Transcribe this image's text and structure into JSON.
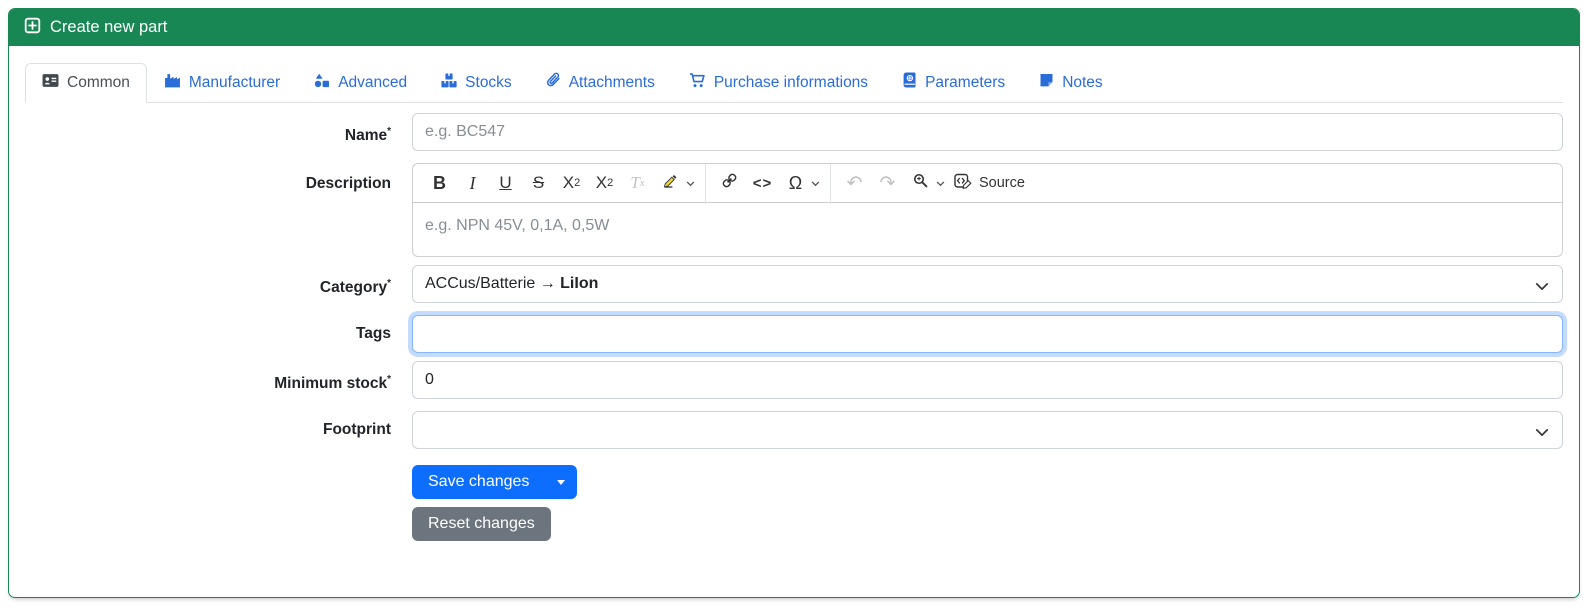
{
  "header": {
    "title": "Create new part",
    "icon": "square-plus-icon",
    "background": "#198754"
  },
  "tabs": [
    {
      "label": "Common",
      "icon": "address-card-icon",
      "active": true
    },
    {
      "label": "Manufacturer",
      "icon": "factory-icon",
      "active": false
    },
    {
      "label": "Advanced",
      "icon": "shapes-icon",
      "active": false
    },
    {
      "label": "Stocks",
      "icon": "boxes-stacked-icon",
      "active": false
    },
    {
      "label": "Attachments",
      "icon": "paperclip-icon",
      "active": false
    },
    {
      "label": "Purchase informations",
      "icon": "shopping-cart-icon",
      "active": false
    },
    {
      "label": "Parameters",
      "icon": "atlas-book-icon",
      "active": false
    },
    {
      "label": "Notes",
      "icon": "sticky-note-icon",
      "active": false
    }
  ],
  "form": {
    "name": {
      "label": "Name",
      "required_marker": "*",
      "placeholder": "e.g. BC547",
      "value": ""
    },
    "description": {
      "label": "Description",
      "placeholder": "e.g. NPN 45V, 0,1A, 0,5W",
      "value": ""
    },
    "category": {
      "label": "Category",
      "required_marker": "*",
      "value_prefix": "ACCus/Batterie → ",
      "value_selected_bold": "LiIon"
    },
    "tags": {
      "label": "Tags",
      "value": "",
      "focused": true
    },
    "minimum_stock": {
      "label": "Minimum stock",
      "required_marker": "*",
      "value": "0"
    },
    "footprint": {
      "label": "Footprint",
      "value": ""
    }
  },
  "editor_toolbar": {
    "items": [
      "bold",
      "italic",
      "underline",
      "strikethrough",
      "subscript",
      "superscript",
      "remove-format",
      "highlight",
      "link",
      "code",
      "special-characters",
      "undo",
      "redo",
      "find-and-replace",
      "source"
    ],
    "bold": "B",
    "italic": "I",
    "underline": "U",
    "strikethrough": "S",
    "subscript_base": "X",
    "subscript_small": "2",
    "superscript_base": "X",
    "superscript_small": "2",
    "remove_format_base": "T",
    "remove_format_small": "x",
    "code_glyph": "<>",
    "omega_glyph": "Ω",
    "undo_glyph": "↶",
    "redo_glyph": "↷",
    "source_label": "Source"
  },
  "buttons": {
    "save_label": "Save changes",
    "reset_label": "Reset changes"
  },
  "colors": {
    "header_green": "#198754",
    "primary_blue": "#0d6efd",
    "secondary_gray": "#6c757d",
    "tab_link_blue": "#2a6cd8",
    "active_tab_text": "#495057",
    "input_border": "#ced4da",
    "focus_border": "#86b7fe",
    "focus_ring": "rgba(13,110,253,0.25)",
    "placeholder_gray": "#868e96",
    "highlighter_yellow": "#f0d637"
  }
}
